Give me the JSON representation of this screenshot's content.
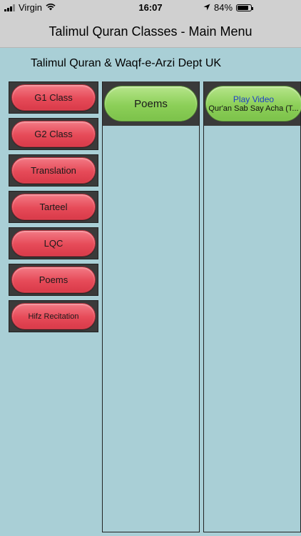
{
  "status_bar": {
    "carrier": "Virgin",
    "time": "16:07",
    "battery": "84%",
    "battery_level": 0.84
  },
  "nav": {
    "title": "Talimul Quran Classes - Main Menu"
  },
  "subtitle": "Talimul Quran & Waqf-e-Arzi Dept UK",
  "menu": [
    {
      "label": "G1 Class"
    },
    {
      "label": "G2 Class"
    },
    {
      "label": "Translation"
    },
    {
      "label": "Tarteel"
    },
    {
      "label": "LQC"
    },
    {
      "label": "Poems"
    },
    {
      "label": "Hifz Recitation"
    }
  ],
  "category_panel": {
    "selected": "Poems"
  },
  "video_panel": {
    "play_label": "Play Video",
    "title": "Qur'an Sab Say Acha (T..."
  },
  "colors": {
    "background": "#a9cfd6",
    "menu_button": "#e64a58",
    "selected_button": "#8ccf58",
    "play_text": "#1e3fc8"
  }
}
